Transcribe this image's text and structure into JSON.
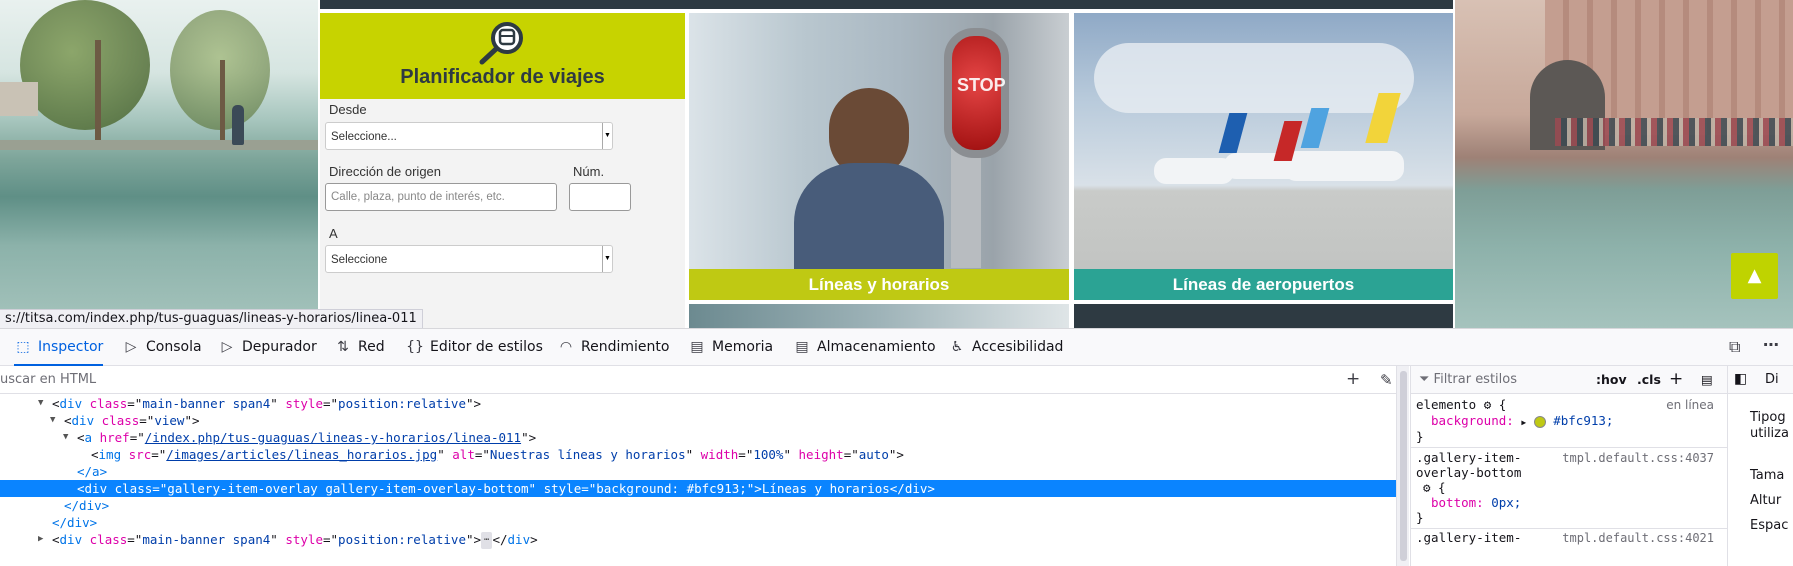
{
  "webpage": {
    "planner": {
      "title": "Planificador de viajes",
      "from_label": "Desde",
      "from_select": "Seleccione...",
      "origin_label": "Dirección de origen",
      "origin_placeholder": "Calle, plaza, punto de interés, etc.",
      "number_label": "Núm.",
      "to_label": "A",
      "to_select": "Seleccione"
    },
    "tiles": {
      "bus_caption": "Líneas y horarios",
      "bus_stop_text": "STOP",
      "air_caption": "Líneas de aeropuertos"
    },
    "colors": {
      "lime": "#bfc913",
      "teal": "#2ba394",
      "dark": "#2e3a42"
    },
    "status_url": "s://titsa.com/index.php/tus-guaguas/lineas-y-horarios/linea-011"
  },
  "devtools": {
    "tabs": [
      {
        "icon": "inspector-icon",
        "label": "Inspector",
        "active": true
      },
      {
        "icon": "console-icon",
        "label": "Consola"
      },
      {
        "icon": "debugger-icon",
        "label": "Depurador"
      },
      {
        "icon": "network-icon",
        "label": "Red"
      },
      {
        "icon": "style-editor-icon",
        "label": "Editor de estilos"
      },
      {
        "icon": "performance-icon",
        "label": "Rendimiento"
      },
      {
        "icon": "memory-icon",
        "label": "Memoria"
      },
      {
        "icon": "storage-icon",
        "label": "Almacenamiento"
      },
      {
        "icon": "accessibility-icon",
        "label": "Accesibilidad"
      }
    ],
    "search_html_placeholder": "uscar en HTML",
    "markup": {
      "l1_tag": "div",
      "l1_class": "main-banner span4",
      "l1_style": "position:relative",
      "l2_tag": "div",
      "l2_class": "view",
      "l3_tag": "a",
      "l3_href": "/index.php/tus-guaguas/lineas-y-horarios/linea-011",
      "l4_tag": "img",
      "l4_src": "/images/articles/lineas_horarios.jpg",
      "l4_alt": "Nuestras líneas y horarios",
      "l4_width": "100%",
      "l4_height": "auto",
      "l5_close": "</a>",
      "l6_selected": "<div class=\"gallery-item-overlay gallery-item-overlay-bottom\" style=\"background: #bfc913;\">Líneas y horarios</div>",
      "l7_close": "</div>",
      "l8_close": "</div>",
      "l9_class": "main-banner span4",
      "l9_style": "position:relative"
    },
    "rules": {
      "filter_placeholder": "Filtrar estilos",
      "hov": ":hov",
      "cls": ".cls",
      "r1_selector": "elemento",
      "r1_source": "en línea",
      "r1_prop": "background:",
      "r1_value": "#bfc913;",
      "r2_selector_a": ".gallery-item-",
      "r2_selector_b": "overlay-bottom",
      "r2_source": "tmpl.default.css:4037",
      "r2_prop": "bottom:",
      "r2_value": "0px;",
      "r3_selector_a": ".gallery-item-",
      "r3_source": "tmpl.default.css:4021"
    },
    "side": {
      "tab_label": "Di",
      "items": [
        "Tipog",
        "utiliza",
        "Tama",
        "Altur",
        "Espac"
      ]
    }
  }
}
